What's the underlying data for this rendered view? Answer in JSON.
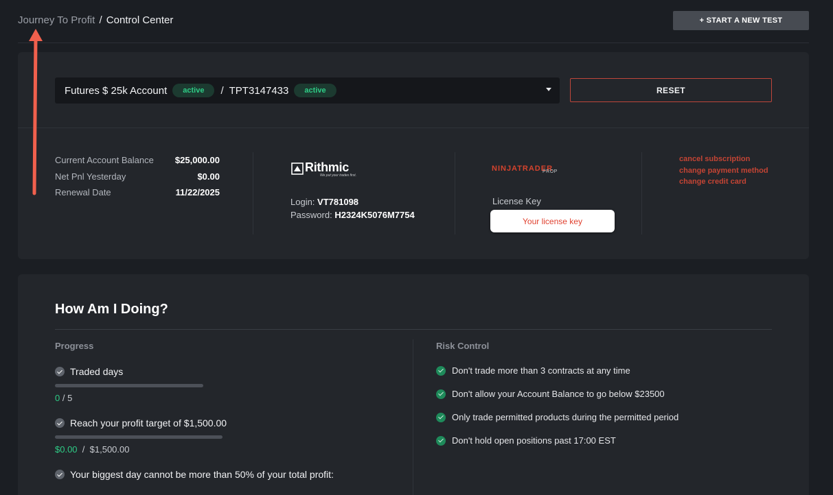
{
  "header": {
    "breadcrumb_link": "Journey To Profit",
    "breadcrumb_sep": "/",
    "breadcrumb_current": "Control Center",
    "start_test_label": "+ START A NEW TEST"
  },
  "account": {
    "name": "Futures $ 25k Account",
    "status": "active",
    "separator": "/",
    "id": "TPT3147433",
    "id_status": "active",
    "reset_label": "RESET",
    "stats": [
      {
        "label": "Current Account Balance",
        "value": "$25,000.00"
      },
      {
        "label": "Net Pnl Yesterday",
        "value": "$0.00"
      },
      {
        "label": "Renewal Date",
        "value": "11/22/2025"
      }
    ],
    "rithmic": {
      "logo_text": "Rithmic",
      "tagline": "We put your trades first.",
      "login_label": "Login:",
      "login_value": "VT781098",
      "password_label": "Password:",
      "password_value": "H2324K5076M7754"
    },
    "ninjatrader": {
      "logo_text": "NINJATRADER",
      "logo_sub": "PROP",
      "license_label": "License Key",
      "license_button": "Your license key"
    },
    "links": [
      "cancel subscription",
      "change payment method",
      "change credit card"
    ]
  },
  "doing": {
    "title": "How Am I Doing?",
    "progress_label": "Progress",
    "risk_label": "Risk Control",
    "progress": [
      {
        "text": "Traded days",
        "current": "0",
        "sep": "/",
        "target": "5",
        "fraction": 0
      },
      {
        "text": "Reach your profit target of $1,500.00",
        "current": "$0.00",
        "sep": "/",
        "target": "$1,500.00",
        "fraction": 0
      },
      {
        "text": "Your biggest day cannot be more than 50% of your total profit:"
      }
    ],
    "risk": [
      "Don't trade more than 3 contracts at any time",
      "Don't allow your Account Balance to go below $23500",
      "Only trade permitted products during the permitted period",
      "Don't hold open positions past 17:00 EST"
    ]
  },
  "colors": {
    "accent_green": "#2ecc86",
    "accent_red": "#c0463b",
    "annotation_arrow": "#f0604d"
  }
}
